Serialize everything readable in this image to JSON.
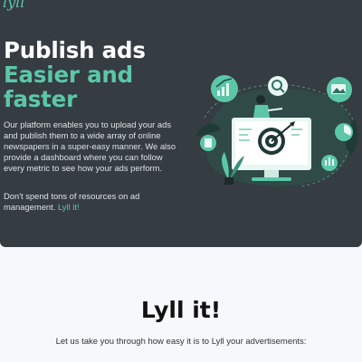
{
  "brand": {
    "logo_text": "lyll"
  },
  "hero": {
    "headline_line1": "Publish ads",
    "headline_line2": "Easier and",
    "headline_line3": "faster",
    "description": "Our platform enables you to upload your ads and publish them to a wide array of online newspapers in a super-easy manner. We also provide a dashboard where you can follow every metric to see how your ads perform.",
    "cta_text": "Don't spend tons of resources on ad management.",
    "cta_link": "Lyll it!"
  },
  "section": {
    "title": "Lyll it!",
    "subtitle": "Let us take you through how easy it is to Lyll your advertisements:"
  },
  "colors": {
    "hero_bg": "#353c42",
    "accent": "#5cc7a8",
    "page_bg": "#f7f8fc"
  },
  "illustration": {
    "icons": [
      "growth-chart-icon",
      "magnifier-icon",
      "image-card-icon",
      "target-icon",
      "gear-chart-icon",
      "pie-chart-icon",
      "document-icon"
    ]
  }
}
